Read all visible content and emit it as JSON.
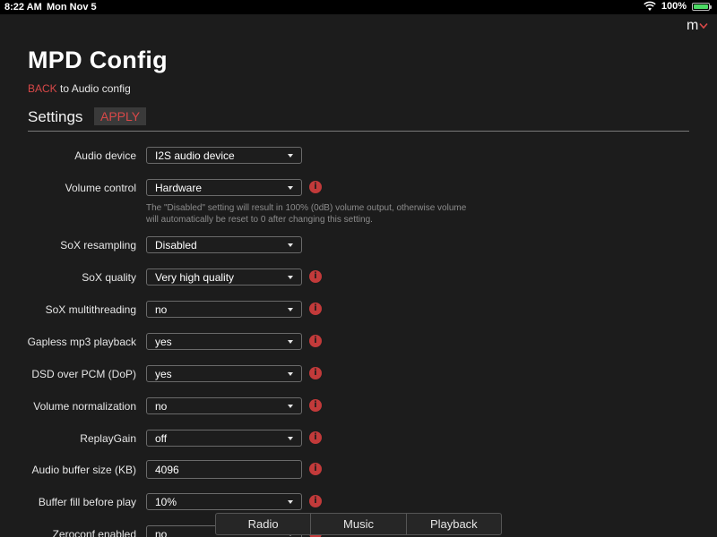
{
  "status_bar": {
    "time": "8:22 AM",
    "date": "Mon Nov 5",
    "battery": "100%",
    "battery_level": 1.0,
    "wifi_icon": "wifi-icon",
    "battery_icon": "battery-icon"
  },
  "brand": {
    "text": "m",
    "icon": "chevron-down-icon",
    "color": "#d94848"
  },
  "page": {
    "title": "MPD Config",
    "back_label": "BACK",
    "back_suffix": " to Audio config"
  },
  "settings": {
    "heading": "Settings",
    "apply_label": "APPLY",
    "volume_help": "The \"Disabled\" setting will result in 100% (0dB) volume output, otherwise volume will automatically be reset to 0 after changing this setting.",
    "rows": [
      {
        "label": "Audio device",
        "value": "I2S audio device",
        "control": "select",
        "info": false
      },
      {
        "label": "Volume control",
        "value": "Hardware",
        "control": "select",
        "info": true
      },
      {
        "label": "SoX resampling",
        "value": "Disabled",
        "control": "select",
        "info": false
      },
      {
        "label": "SoX quality",
        "value": "Very high quality",
        "control": "select",
        "info": true
      },
      {
        "label": "SoX multithreading",
        "value": "no",
        "control": "select",
        "info": true
      },
      {
        "label": "Gapless mp3 playback",
        "value": "yes",
        "control": "select",
        "info": true
      },
      {
        "label": "DSD over PCM (DoP)",
        "value": "yes",
        "control": "select",
        "info": true
      },
      {
        "label": "Volume normalization",
        "value": "no",
        "control": "select",
        "info": true
      },
      {
        "label": "ReplayGain",
        "value": "off",
        "control": "select",
        "info": true
      },
      {
        "label": "Audio buffer size (KB)",
        "value": "4096",
        "control": "input",
        "info": true
      },
      {
        "label": "Buffer fill before play",
        "value": "10%",
        "control": "select",
        "info": true
      },
      {
        "label": "Zeroconf enabled",
        "value": "no",
        "control": "select",
        "info": true
      }
    ]
  },
  "bottom_nav": {
    "tabs": [
      "Radio",
      "Music",
      "Playback"
    ]
  },
  "colors": {
    "accent": "#d94848",
    "background": "#1c1c1c",
    "info": "#c23a3a"
  }
}
